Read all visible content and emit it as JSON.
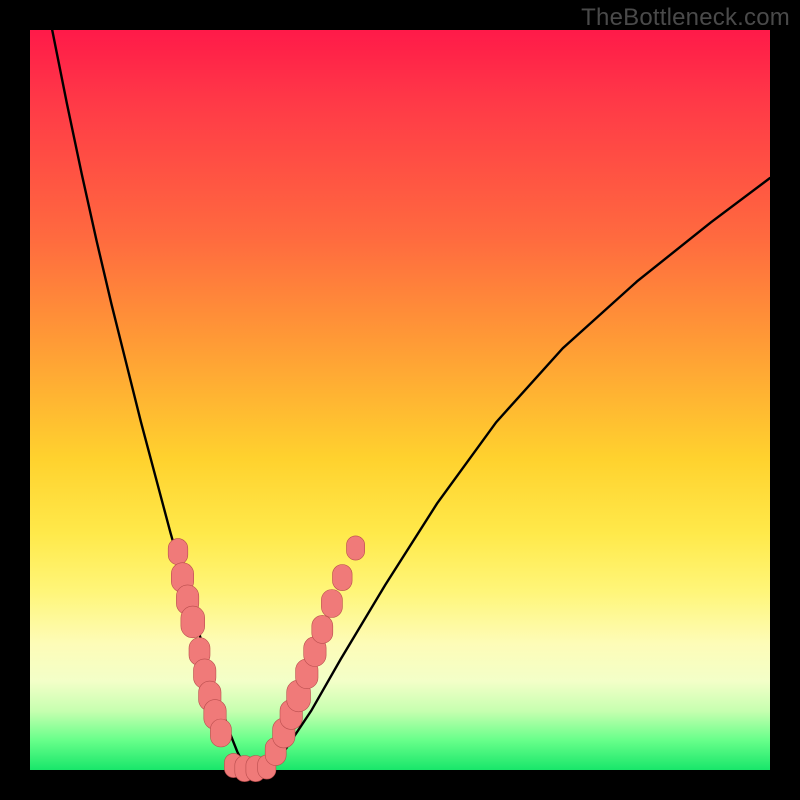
{
  "watermark": "TheBottleneck.com",
  "colors": {
    "frame": "#000000",
    "curve": "#000000",
    "marker_fill": "#f07a79",
    "marker_stroke": "#b94d4d"
  },
  "chart_data": {
    "type": "line",
    "title": "",
    "xlabel": "",
    "ylabel": "",
    "xlim": [
      0,
      100
    ],
    "ylim": [
      0,
      100
    ],
    "grid": false,
    "legend": false,
    "series": [
      {
        "name": "bottleneck-curve",
        "x": [
          3,
          5,
          7,
          9,
          11,
          13,
          15,
          17,
          19,
          20,
          21,
          22,
          23,
          24,
          25,
          26,
          27,
          28,
          29,
          30,
          32,
          34,
          38,
          42,
          48,
          55,
          63,
          72,
          82,
          92,
          100
        ],
        "y": [
          100,
          90,
          80.5,
          71.5,
          63,
          55,
          47,
          39.5,
          32,
          28.5,
          25,
          21.5,
          18,
          14.5,
          11,
          8,
          5,
          2.5,
          0.5,
          0,
          0,
          2,
          8,
          15,
          25,
          36,
          47,
          57,
          66,
          74,
          80
        ]
      }
    ],
    "markers": {
      "note": "salmon rounded markers clustered near the valley of the curve",
      "left_branch": [
        {
          "x": 20.0,
          "y": 29.5,
          "r": 1.4
        },
        {
          "x": 20.6,
          "y": 26.0,
          "r": 1.6
        },
        {
          "x": 21.3,
          "y": 23.0,
          "r": 1.6
        },
        {
          "x": 22.0,
          "y": 20.0,
          "r": 1.7
        },
        {
          "x": 22.9,
          "y": 16.0,
          "r": 1.5
        },
        {
          "x": 23.6,
          "y": 13.0,
          "r": 1.6
        },
        {
          "x": 24.3,
          "y": 10.0,
          "r": 1.6
        },
        {
          "x": 25.0,
          "y": 7.5,
          "r": 1.6
        },
        {
          "x": 25.8,
          "y": 5.0,
          "r": 1.5
        }
      ],
      "valley": [
        {
          "x": 27.5,
          "y": 0.6,
          "r": 1.3
        },
        {
          "x": 29.0,
          "y": 0.2,
          "r": 1.4
        },
        {
          "x": 30.5,
          "y": 0.2,
          "r": 1.4
        },
        {
          "x": 32.0,
          "y": 0.4,
          "r": 1.3
        }
      ],
      "right_branch": [
        {
          "x": 33.2,
          "y": 2.5,
          "r": 1.5
        },
        {
          "x": 34.3,
          "y": 5.0,
          "r": 1.6
        },
        {
          "x": 35.3,
          "y": 7.5,
          "r": 1.6
        },
        {
          "x": 36.3,
          "y": 10.0,
          "r": 1.7
        },
        {
          "x": 37.4,
          "y": 13.0,
          "r": 1.6
        },
        {
          "x": 38.5,
          "y": 16.0,
          "r": 1.6
        },
        {
          "x": 39.5,
          "y": 19.0,
          "r": 1.5
        },
        {
          "x": 40.8,
          "y": 22.5,
          "r": 1.5
        },
        {
          "x": 42.2,
          "y": 26.0,
          "r": 1.4
        },
        {
          "x": 44.0,
          "y": 30.0,
          "r": 1.3
        }
      ]
    }
  }
}
